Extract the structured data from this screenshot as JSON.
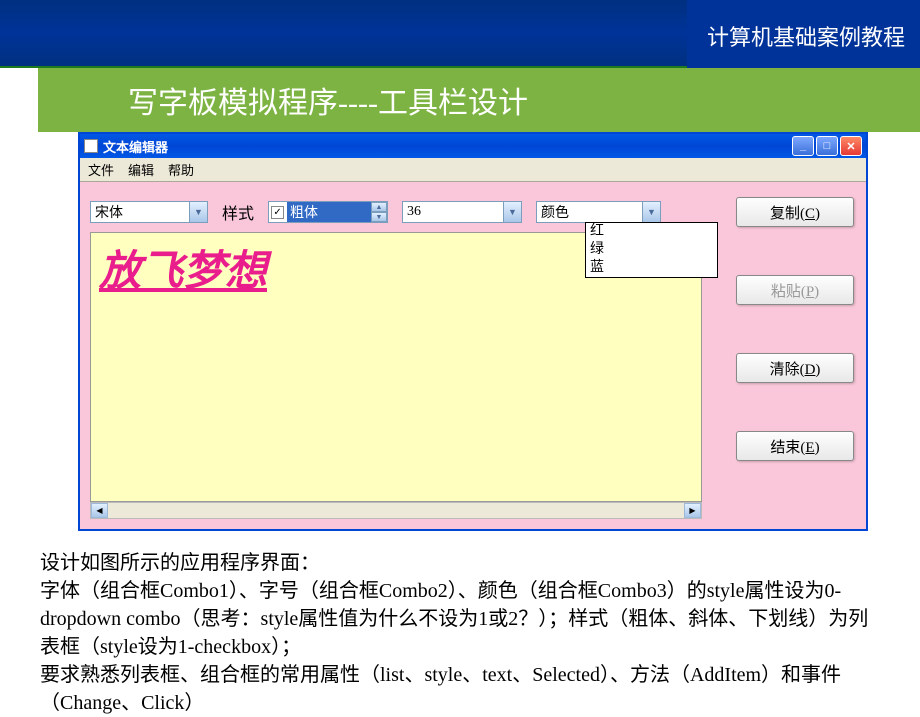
{
  "header": {
    "corner_title": "计算机基础案例教程"
  },
  "slide": {
    "title": "写字板模拟程序----工具栏设计"
  },
  "window": {
    "title": "文本编辑器",
    "menus": [
      "文件",
      "编辑",
      "帮助"
    ]
  },
  "toolbar": {
    "font_combo": "宋体",
    "style_label": "样式",
    "style_listbox": "粗体",
    "size_combo": "36",
    "color_combo": "颜色",
    "color_options": [
      "红",
      "绿",
      "蓝"
    ]
  },
  "textarea": {
    "content": "放飞梦想"
  },
  "buttons": {
    "copy": "复制(C)",
    "paste": "粘贴(P)",
    "clear": "清除(D)",
    "exit": "结束(E)"
  },
  "description": {
    "line1": "设计如图所示的应用程序界面：",
    "line2": "字体（组合框Combo1）、字号（组合框Combo2）、颜色（组合框Combo3）的style属性设为0-dropdown combo（思考：style属性值为什么不设为1或2？）；样式（粗体、斜体、下划线）为列表框（style设为1-checkbox）；",
    "line3": "要求熟悉列表框、组合框的常用属性（list、style、text、Selected）、方法（AddItem）和事件（Change、Click）"
  }
}
